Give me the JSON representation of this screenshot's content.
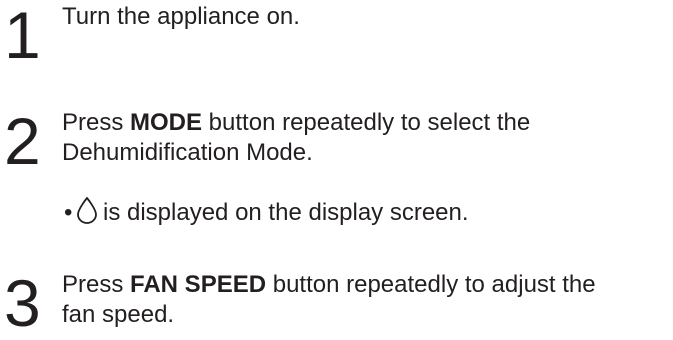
{
  "steps": [
    {
      "number": "1",
      "text": "Turn the appliance on."
    },
    {
      "number": "2",
      "prefix": "Press ",
      "bold": "MODE",
      "suffix_line1": " button repeatedly to select the",
      "line2": "Dehumidification Mode.",
      "note": {
        "bullet": "•",
        "icon": "water-drop-icon",
        "text": "is displayed on the display screen."
      }
    },
    {
      "number": "3",
      "prefix": "Press ",
      "bold": "FAN SPEED",
      "suffix_line1": " button repeatedly to adjust the",
      "line2": "fan speed."
    }
  ]
}
